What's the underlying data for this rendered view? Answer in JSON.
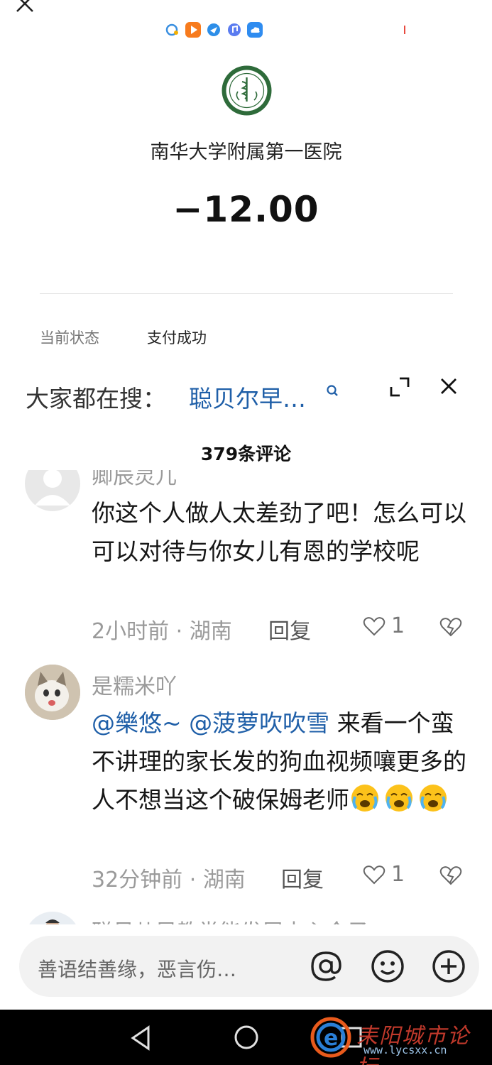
{
  "merchant": {
    "name": "南华大学附属第一医院"
  },
  "payment": {
    "amount": "−12.00",
    "status_label": "当前状态",
    "status_value": "支付成功"
  },
  "hot_search": {
    "label": "大家都在搜：",
    "term": "聪贝尔早…"
  },
  "comments_header": {
    "count_text": "379条评论"
  },
  "comments": [
    {
      "username": "卿辰灵儿",
      "text": "你这个人做人太差劲了吧！怎么可以可以对待与你女儿有恩的学校呢",
      "time": "2小时前",
      "location": "湖南",
      "reply": "回复",
      "likes": "1"
    },
    {
      "username": "是糯米吖",
      "mention1": "@樂悠~",
      "mention2": "@菠萝吹吹雪",
      "text": " 来看一个蛮不讲理的家长发的狗血视频嚷更多的人不想当这个破保姆老师",
      "time": "32分钟前",
      "location": "湖南",
      "reply": "回复",
      "likes": "1"
    },
    {
      "username": "聪贝儿早教党能发展中心今子"
    }
  ],
  "input": {
    "placeholder": "善语结善缘，恶言伤…"
  },
  "watermark": {
    "text": "耒阳城市论坛",
    "url": "www.lycsxx.cn"
  },
  "colors": {
    "link": "#1f5fa8",
    "muted": "#9a9a9a",
    "input_bg": "#f2f2f2"
  }
}
